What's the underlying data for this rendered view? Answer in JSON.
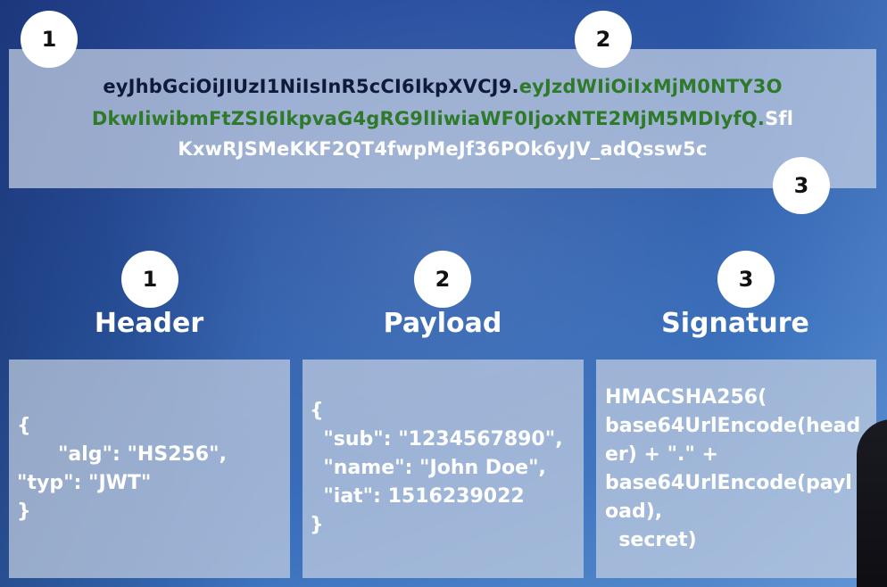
{
  "token": {
    "line1_header": "eyJhbGciOiJIUzI1NiIsInR5cCI6IkpXVCJ9",
    "line1_dot": ".",
    "line1_payload": "eyJzdWIiOiIxMjM0NTY3O",
    "line2_payload": "DkwIiwibmFtZSI6IkpvaG4gRG9lIiwiaWF0IjoxNTE2MjM5MDIyfQ",
    "line2_dot": ".",
    "line2_sig": "Sfl",
    "line3_sig": "KxwRJSMeKKF2QT4fwpMeJf36POk6yJV_adQssw5c",
    "badges": [
      "1",
      "2",
      "3"
    ]
  },
  "sections": [
    {
      "badge": "1",
      "title": "Header",
      "lines": [
        "{",
        "      \"alg\": \"HS256\",",
        "\"typ\": \"JWT\"",
        "}"
      ]
    },
    {
      "badge": "2",
      "title": "Payload",
      "lines": [
        "{",
        "  \"sub\": \"1234567890\",",
        "  \"name\": \"John Doe\",",
        "  \"iat\": 1516239022",
        "}"
      ]
    },
    {
      "badge": "3",
      "title": "Signature",
      "lines": [
        "HMACSHA256(",
        "base64UrlEncode(head",
        "er) + \".\" +",
        "base64UrlEncode(payl",
        "oad),",
        "  secret)"
      ]
    }
  ],
  "colors": {
    "header_segment": "#0f1a3a",
    "payload_segment": "#2f7a2a",
    "signature_segment": "#ffffff"
  }
}
